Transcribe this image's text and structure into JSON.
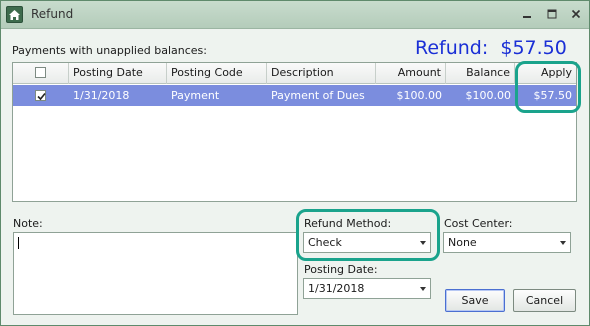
{
  "window": {
    "title": "Refund"
  },
  "icons": {
    "app": "home-icon",
    "minimize": "minimize-icon",
    "maximize": "maximize-icon",
    "close": "close-icon"
  },
  "payments_label": "Payments with unapplied balances:",
  "refund_total": "Refund:  $57.50",
  "grid": {
    "headers": [
      "",
      "Posting Date",
      "Posting Code",
      "Description",
      "Amount",
      "Balance",
      "Apply"
    ],
    "rows": [
      {
        "checked": true,
        "posting_date": "1/31/2018",
        "posting_code": "Payment",
        "description": "Payment of Dues",
        "amount": "$100.00",
        "balance": "$100.00",
        "apply": "$57.50"
      }
    ]
  },
  "note": {
    "label": "Note:",
    "value": ""
  },
  "refund_method": {
    "label": "Refund Method:",
    "value": "Check"
  },
  "cost_center": {
    "label": "Cost Center:",
    "value": "None"
  },
  "posting_date": {
    "label": "Posting Date:",
    "value": "1/31/2018"
  },
  "buttons": {
    "save": "Save",
    "cancel": "Cancel"
  },
  "colors": {
    "accent_text": "#1a2fd6",
    "selected_row": "#7b8dde",
    "callout": "#1aa38c",
    "title_bar": "#c8dccd"
  }
}
